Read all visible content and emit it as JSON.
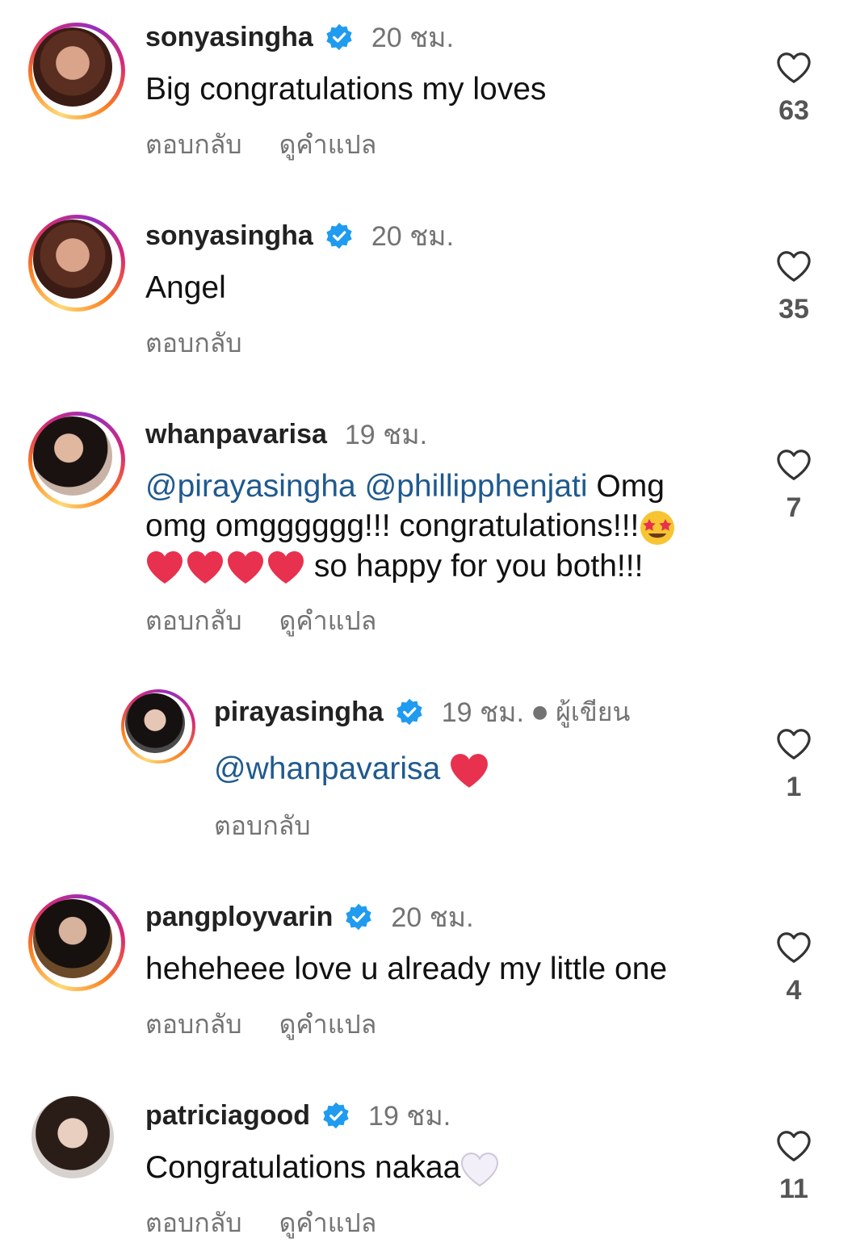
{
  "colors": {
    "accent_blue": "#1f9bf0",
    "mention": "#1f5a8f",
    "muted": "#737373",
    "heart_red": "#e8304f"
  },
  "labels": {
    "reply": "ตอบกลับ",
    "translate": "ดูคำแปล",
    "author": "ผู้เขียน"
  },
  "comments": [
    {
      "username": "sonyasingha",
      "verified": true,
      "time": "20 ชม.",
      "text": "Big congratulations my loves",
      "likes": "63",
      "has_translate": true
    },
    {
      "username": "sonyasingha",
      "verified": true,
      "time": "20 ชม.",
      "text": "Angel",
      "likes": "35",
      "has_translate": false
    },
    {
      "username": "whanpavarisa",
      "verified": false,
      "time": "19 ชม.",
      "mention1": "@pirayasingha",
      "mention2": "@phillipphenjati",
      "text_a": " Omg omg omgggggg!!! congratulations!!!",
      "text_b": " so happy for you both!!!",
      "likes": "7",
      "has_translate": true
    },
    {
      "username": "pirayasingha",
      "verified": true,
      "time": "19 ชม.",
      "mention": "@whanpavarisa",
      "likes": "1",
      "has_translate": false,
      "reply": true
    },
    {
      "username": "pangployvarin",
      "verified": true,
      "time": "20 ชม.",
      "text": "heheheee love u already my little one",
      "likes": "4",
      "has_translate": true
    },
    {
      "username": "patriciagood",
      "verified": true,
      "time": "19 ชม.",
      "text": "Congratulations nakaa",
      "likes": "11",
      "has_translate": true
    }
  ]
}
